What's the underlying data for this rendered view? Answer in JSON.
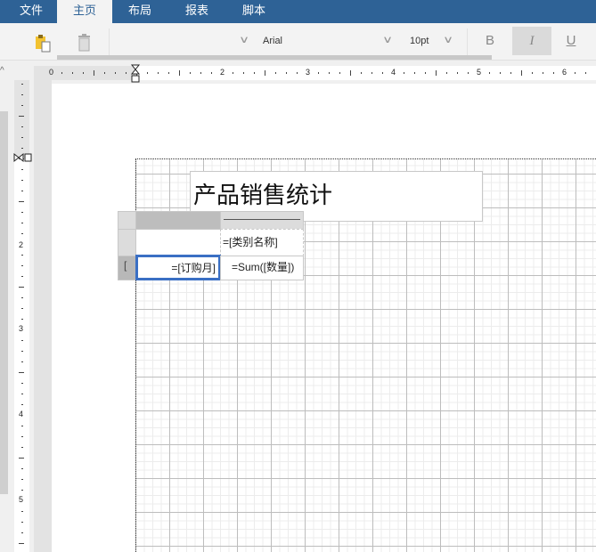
{
  "menu": {
    "tabs": [
      {
        "label": "文件"
      },
      {
        "label": "主页",
        "active": true
      },
      {
        "label": "布局"
      },
      {
        "label": "报表"
      },
      {
        "label": "脚本"
      }
    ]
  },
  "toolbar": {
    "font_name": "Arial",
    "font_size": "10pt",
    "bold": "B",
    "italic": "I",
    "underline": "U"
  },
  "ruler": {
    "h_labels": [
      "0",
      "2",
      "3",
      "4",
      "5",
      "6"
    ],
    "v_labels": [
      "2",
      "3",
      "4",
      "5"
    ]
  },
  "report": {
    "title": "产品销售统计",
    "col_header_field": "=[类别名称]",
    "row_field": "=[订购月]",
    "value_field": "=Sum([数量])",
    "row_bracket": "["
  },
  "colors": {
    "accent": "#2e6296",
    "selection": "#3a6fc4"
  }
}
